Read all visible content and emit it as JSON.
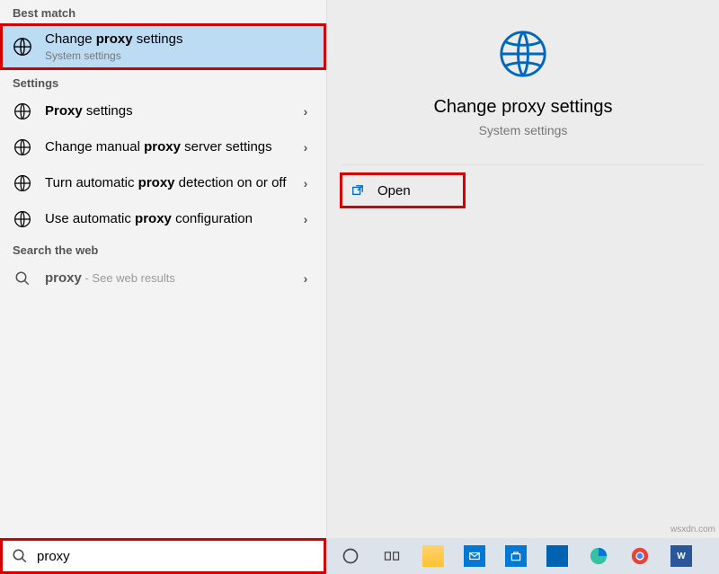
{
  "sections": {
    "best_match": "Best match",
    "settings": "Settings",
    "web": "Search the web"
  },
  "best_match": {
    "title_pre": "Change ",
    "title_bold": "proxy",
    "title_post": " settings",
    "subtitle": "System settings"
  },
  "settings_items": [
    {
      "pre": "",
      "bold": "Proxy",
      "post": " settings"
    },
    {
      "pre": "Change manual ",
      "bold": "proxy",
      "post": " server settings"
    },
    {
      "pre": "Turn automatic ",
      "bold": "proxy",
      "post": " detection on or off"
    },
    {
      "pre": "Use automatic ",
      "bold": "proxy",
      "post": " configuration"
    }
  ],
  "web_item": {
    "term": "proxy",
    "suffix": " - See web results"
  },
  "detail": {
    "title": "Change proxy settings",
    "subtitle": "System settings",
    "open_label": "Open"
  },
  "search": {
    "value": "proxy"
  },
  "watermark": "wsxdn.com"
}
